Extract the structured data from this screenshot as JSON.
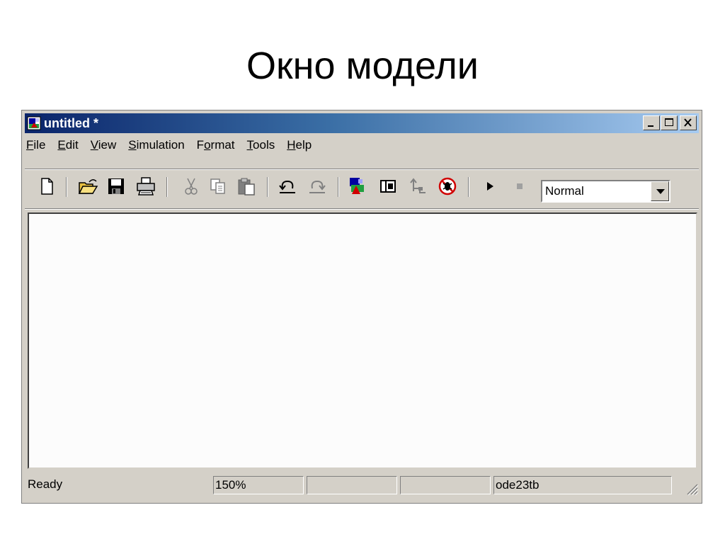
{
  "slide": {
    "title": "Окно модели"
  },
  "window": {
    "title": "untitled *",
    "icon": "simulink-model-icon",
    "controls": [
      "minimize-icon",
      "maximize-icon",
      "close-icon"
    ]
  },
  "menu": {
    "file": {
      "accel": "F",
      "rest": "ile"
    },
    "edit": {
      "accel": "E",
      "rest": "dit"
    },
    "view": {
      "accel": "V",
      "rest": "iew"
    },
    "simulation": {
      "accel": "S",
      "rest": "imulation"
    },
    "format": {
      "pre": "F",
      "accel": "o",
      "rest": "rmat"
    },
    "tools": {
      "accel": "T",
      "rest": "ools"
    },
    "help": {
      "accel": "H",
      "rest": "elp"
    }
  },
  "toolbar": {
    "icons": [
      "new-document-icon",
      "open-folder-icon",
      "save-icon",
      "print-icon",
      "cut-icon",
      "copy-icon",
      "paste-icon",
      "undo-icon",
      "redo-icon",
      "library-browser-icon",
      "model-browser-icon",
      "go-to-parent-icon",
      "debug-icon",
      "start-simulation-icon",
      "stop-simulation-icon"
    ],
    "mode_dropdown": {
      "value": "Normal"
    }
  },
  "status": {
    "state": "Ready",
    "zoom": "150%",
    "cell3": "",
    "cell4": "",
    "solver": "ode23tb"
  },
  "colors": {
    "titlebar_start": "#0a246a",
    "titlebar_end": "#a6caf0",
    "chrome": "#d4d0c8",
    "canvas": "#fcfcfc"
  }
}
